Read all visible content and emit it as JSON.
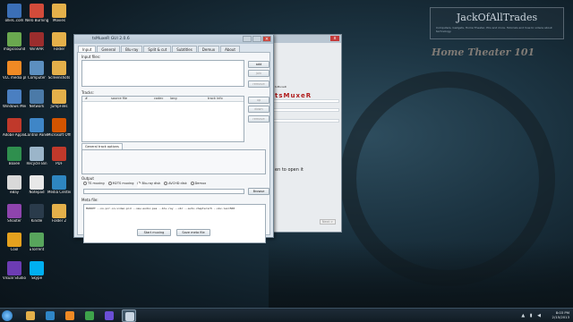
{
  "branding": {
    "logo_title": "JackOfAllTrades",
    "logo_subtitle": "Computers, Gadgets, Home Theater, PCs and more. Tutorials and how-to videos about technology.",
    "tagline": "Home Theater 101"
  },
  "desktop_icons": [
    {
      "label": "ollieC.com",
      "color": "#3b6fb6"
    },
    {
      "label": "magicsound",
      "color": "#6aa84f"
    },
    {
      "label": "VLC media player",
      "color": "#f08a24"
    },
    {
      "label": "Windows Media Player",
      "color": "#4a7fc1"
    },
    {
      "label": "Adobe Application Manager",
      "color": "#c0392b"
    },
    {
      "label": "Boxee",
      "color": "#2f8f4e"
    },
    {
      "label": "eBay",
      "color": "#d9d9d9"
    },
    {
      "label": "Shooter",
      "color": "#8e44ad"
    },
    {
      "label": "Cool",
      "color": "#e5a11e"
    },
    {
      "label": "Visual Studio",
      "color": "#6c3cb3"
    },
    {
      "label": "Nero Burning ROM",
      "color": "#d24b3a"
    },
    {
      "label": "WinRAR",
      "color": "#9b2d2d"
    },
    {
      "label": "Computer",
      "color": "#5c8fbf"
    },
    {
      "label": "Network",
      "color": "#4b7aa8"
    },
    {
      "label": "Control Panel",
      "color": "#3f86c7"
    },
    {
      "label": "Recycle Bin",
      "color": "#9bb5c9"
    },
    {
      "label": "Notepad",
      "color": "#e8e8e8"
    },
    {
      "label": "Kindle",
      "color": "#2a3b4b"
    },
    {
      "label": "uTorrent",
      "color": "#58a55c"
    },
    {
      "label": "Skype",
      "color": "#00aff0"
    },
    {
      "label": "Movies",
      "color": "#e4b04a"
    },
    {
      "label": "Folder",
      "color": "#e4b04a"
    },
    {
      "label": "Screenshots",
      "color": "#e4b04a"
    },
    {
      "label": "JumpFiles",
      "color": "#e4b04a"
    },
    {
      "label": "Microsoft Office",
      "color": "#d35400"
    },
    {
      "label": "PDF",
      "color": "#c0392b"
    },
    {
      "label": "Media Center",
      "color": "#2e86c1"
    },
    {
      "label": "Folder 2",
      "color": "#e4b04a"
    }
  ],
  "main_window": {
    "title": "tsMuxeR GUI 2.0.6",
    "tabs": [
      "Input",
      "General",
      "Blu-ray",
      "Split & cut",
      "Subtitles",
      "Demux",
      "About"
    ],
    "input_files_label": "Input files:",
    "add_button": "add",
    "join_button": "join",
    "remove_button": "remove",
    "tracks_label": "Tracks:",
    "tracks_columns": [
      "#",
      "source file",
      "codec",
      "lang",
      "track info"
    ],
    "up_button": "up",
    "down_button": "down",
    "remove_track_button": "remove",
    "general_track_options_tab": "General track options",
    "output_label": "Output",
    "output_options": [
      "TS muxing",
      "M2TS muxing",
      "Blu-ray disk",
      "AVCHD disk",
      "Demux"
    ],
    "output_selected": "Blu-ray disk",
    "browse_button": "Browse",
    "meta_file_label": "Meta file:",
    "meta_content": "MUXOPT --no-pcr-on-video-pid --new-audio-pes --blu-ray --vbr --auto-chapters=5 --vbv-len=500",
    "start_muxing_button": "Start muxing",
    "save_meta_button": "Save meta file"
  },
  "back_window": {
    "close_label": "x",
    "small_text": "tsMuxeR",
    "red_text": "tsMuxeR",
    "open_hint": "en to open it",
    "next_button": "Next >"
  },
  "taskbar": {
    "items": [
      {
        "name": "explorer",
        "color": "#e4b04a"
      },
      {
        "name": "internet-explorer",
        "color": "#2f86c7"
      },
      {
        "name": "media-player",
        "color": "#f08a24"
      },
      {
        "name": "green-app",
        "color": "#3ea34b"
      },
      {
        "name": "adobe-after-effects",
        "color": "#6b4fd6"
      },
      {
        "name": "tsmuxer",
        "color": "#c9d6e2"
      }
    ],
    "time": "8:03 PM",
    "date": "2/15/2013"
  }
}
